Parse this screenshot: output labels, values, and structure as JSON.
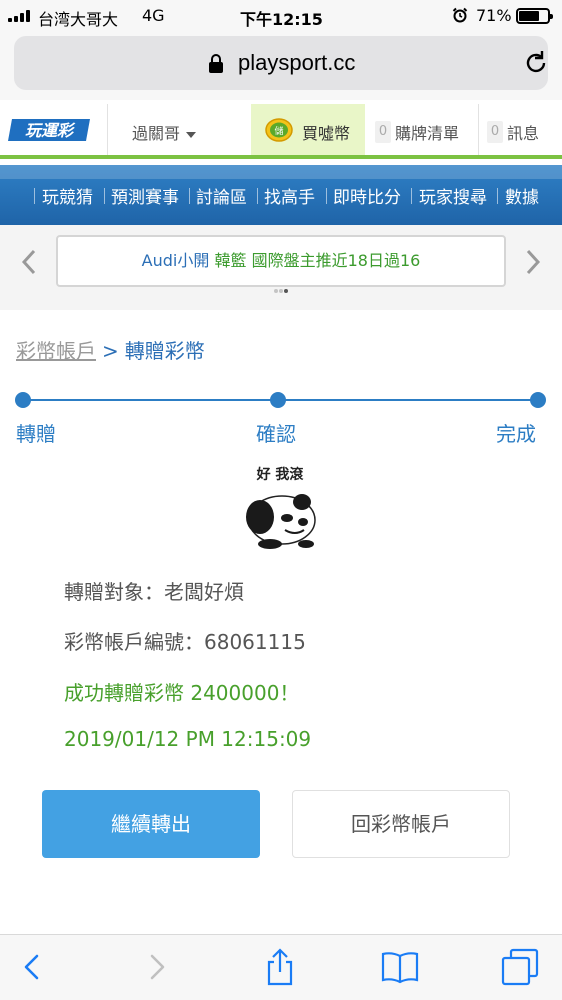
{
  "status_bar": {
    "carrier": "台湾大哥大",
    "network": "4G",
    "time": "下午12:15",
    "battery_percent_label": "71%",
    "battery_level": 0.71
  },
  "browser": {
    "url": "playsport.cc"
  },
  "site_header": {
    "user_menu": "過關哥",
    "buy_coins": "買噓幣",
    "coin_icon_text": "儲",
    "purchase_list_count": "0",
    "purchase_list": "購牌清單",
    "messages_count": "0",
    "messages": "訊息"
  },
  "nav": {
    "items": [
      "玩競猜",
      "預測賽事",
      "討論區",
      "找高手",
      "即時比分",
      "玩家搜尋",
      "數據"
    ]
  },
  "ticker": {
    "brand": "Audi小開",
    "team": "韓籃",
    "headline": "國際盤主推近18日過16"
  },
  "breadcrumb": {
    "parent": "彩幣帳戶",
    "separator": ">",
    "current": "轉贈彩幣"
  },
  "steps": [
    "轉贈",
    "確認",
    "完成"
  ],
  "meme": {
    "caption": "好 我滾"
  },
  "result": {
    "recipient": "轉贈對象：老闆好煩",
    "account_no": "彩幣帳戶編號：68061115",
    "success": "成功轉贈彩幣 2400000！",
    "timestamp": "2019/01/12 PM 12:15:09"
  },
  "buttons": {
    "continue": "繼續轉出",
    "back_to_account": "回彩幣帳戶"
  },
  "colors": {
    "accent_blue": "#2c7dc4",
    "success_green": "#48a02c",
    "nav_green_line": "#7cc242",
    "button_blue": "#43a1e3"
  }
}
